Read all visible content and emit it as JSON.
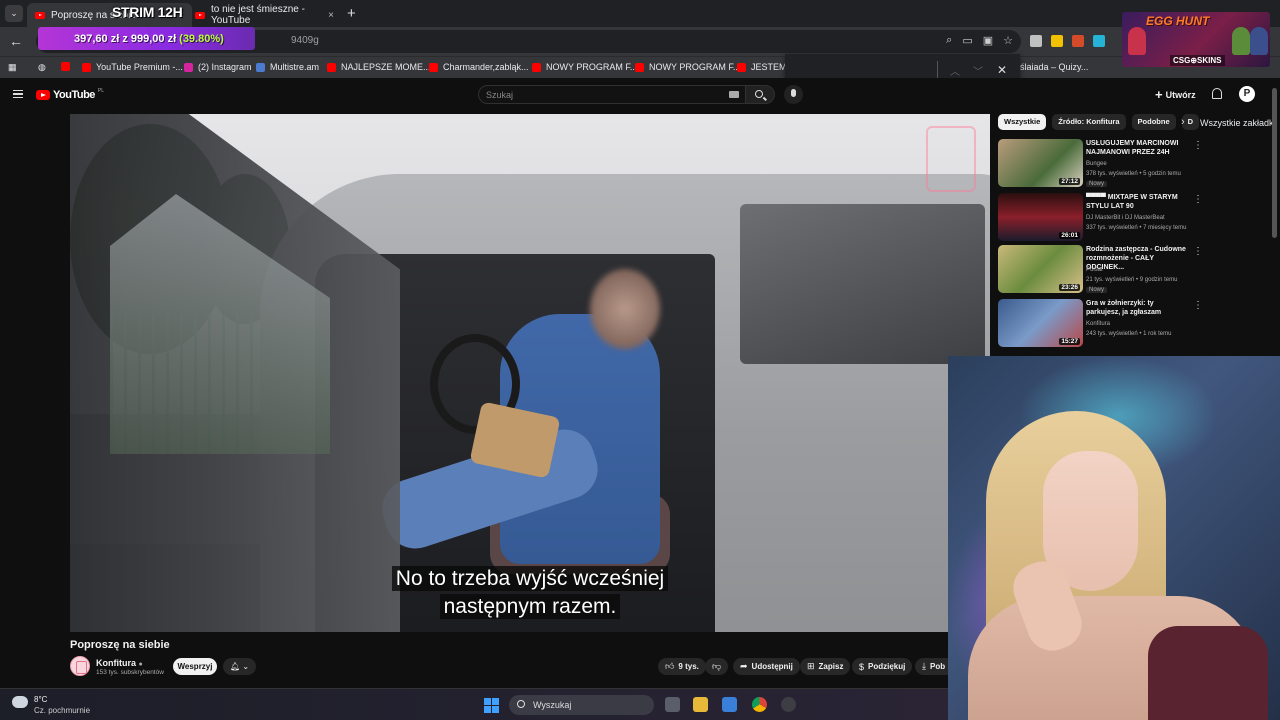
{
  "browser": {
    "tabs": [
      {
        "label": "Poproszę na siebie",
        "active": true
      },
      {
        "label": "to nie jest śmieszne - YouTube",
        "active": false
      }
    ],
    "tab_close": "×",
    "new_tab": "+",
    "url_fragment": "9409g",
    "bookmarks": [
      {
        "label": "YouTube Premium -...",
        "icon": "youtube-icon"
      },
      {
        "label": "(2) Instagram",
        "icon": "instagram-icon"
      },
      {
        "label": "Multistre.am",
        "icon": "multistream-icon"
      },
      {
        "label": "NAJLEPSZE MOME...",
        "icon": "youtube-icon"
      },
      {
        "label": "Charmander,zabląk...",
        "icon": "youtube-icon"
      },
      {
        "label": "NOWY PROGRAM F...",
        "icon": "youtube-icon"
      },
      {
        "label": "NOWY PROGRAM F...",
        "icon": "youtube-icon"
      },
      {
        "label": "JESTEM D",
        "icon": "youtube-icon"
      },
      {
        "label": "ślaiada – Quizy...",
        "icon": "quiz-icon"
      }
    ],
    "all_bookmarks": "Wszystkie zakładki"
  },
  "stream_overlay": {
    "title": "STRIM 12H",
    "goal_current": "397,60 zł",
    "goal_sep": "z",
    "goal_target": "999,00 zł",
    "goal_percent": "(39.80%)",
    "sponsor_title": "EGG HUNT",
    "sponsor_sub": "CSG⊕SKINS"
  },
  "youtube": {
    "logo": "YouTube",
    "logo_region": "PL",
    "search_placeholder": "Szukaj",
    "create_label": "Utwórz",
    "avatar_letter": "P",
    "video": {
      "title": "Poproszę na siebie",
      "subtitle_line1": "No to trzeba wyjść wcześniej",
      "subtitle_line2": "następnym razem."
    },
    "channel": {
      "name": "Konfitura",
      "subscribers": "153 tys. subskrybentów",
      "join_label": "Wesprzyj"
    },
    "actions": {
      "likes": "9 tys.",
      "share": "Udostępnij",
      "save": "Zapisz",
      "thanks": "Podziękuj",
      "download": "Pob"
    },
    "chips": [
      "Wszystkie",
      "Źródło: Konfitura",
      "Podobne",
      "D"
    ],
    "recommendations": [
      {
        "title": "USŁUGUJEMY MARCINOWI NAJMANOWI PRZEZ 24H",
        "channel": "Bungee",
        "meta": "378 tys. wyświetleń • 5 godzin temu",
        "badge": "Nowy",
        "duration": "27:12"
      },
      {
        "title": "▀▀▀▀ MIXTAPE W STARYM STYLU LAT 90",
        "channel": "DJ MasterBit i DJ MasterBeat",
        "meta": "337 tys. wyświetleń • 7 miesięcy temu",
        "badge": "",
        "duration": "26:01"
      },
      {
        "title": "Rodzina zastępcza - Cudowne rozmnożenie - CAŁY ODCINEK...",
        "channel": "Polsat",
        "meta": "21 tys. wyświetleń • 9 godzin temu",
        "badge": "Nowy",
        "duration": "23:26"
      },
      {
        "title": "Gra w żołnierzyki: ty parkujesz, ja zgłaszam",
        "channel": "Konfitura",
        "meta": "243 tys. wyświetleń • 1 rok temu",
        "badge": "",
        "duration": "15:27"
      }
    ]
  },
  "taskbar": {
    "temperature": "8°C",
    "weather": "Cz. pochmurnie",
    "search_placeholder": "Wyszukaj"
  }
}
